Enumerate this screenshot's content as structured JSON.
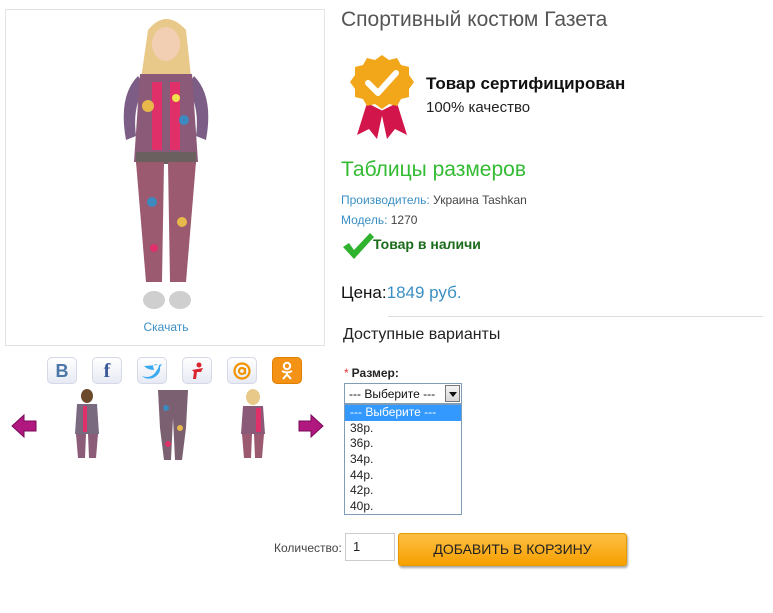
{
  "product": {
    "title": "Спортивный костюм Газета",
    "download_label": "Скачать"
  },
  "certificate": {
    "title": "Товар сертифицирован",
    "subtitle": "100% качество"
  },
  "size_tables_link": "Таблицы размеров",
  "specs": {
    "manufacturer_label": "Производитель:",
    "manufacturer_value": "Украина Tashkan",
    "model_label": "Модель:",
    "model_value": "1270"
  },
  "stock": {
    "text": "Товар в наличи"
  },
  "price": {
    "label": "Цена:",
    "value": "1849 руб."
  },
  "variants": {
    "title": "Доступные варианты",
    "size_label": "Размер:",
    "required_mark": "*",
    "selected": "--- Выберите ---",
    "options": [
      "--- Выберите ---",
      "38р.",
      "36р.",
      "34р.",
      "44р.",
      "42р.",
      "40р."
    ]
  },
  "quantity": {
    "label": "Количество:",
    "value": "1"
  },
  "cart": {
    "button_label": "ДОБАВИТЬ В КОРЗИНУ"
  },
  "social": {
    "vk_glyph": "В",
    "fb_glyph": "f"
  },
  "colors": {
    "accent_blue": "#3a8fc4",
    "size_tables_green": "#33bb33",
    "stock_green": "#1a6b1a",
    "button_orange": "#f7a000",
    "selection_blue": "#3399ff"
  }
}
